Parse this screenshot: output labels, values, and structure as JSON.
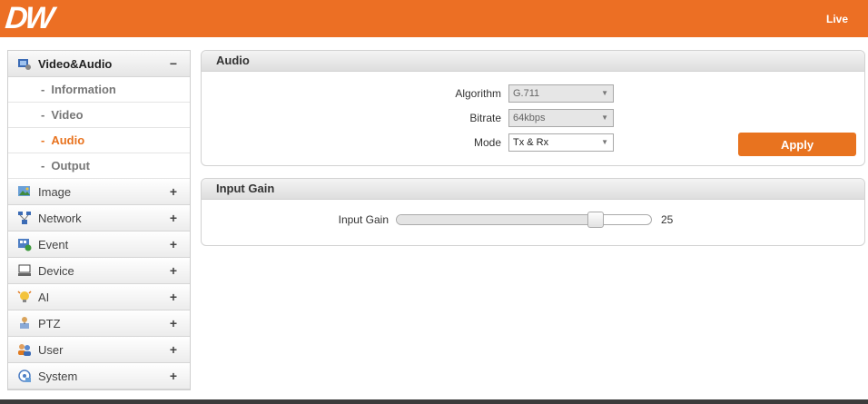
{
  "header": {
    "logo": "DW",
    "live_link": "Live"
  },
  "sidebar": {
    "groups": [
      {
        "label": "Video&Audio",
        "sign": "−",
        "icon": "video-audio-icon",
        "open": true
      },
      {
        "label": "Image",
        "sign": "+",
        "icon": "image-icon"
      },
      {
        "label": "Network",
        "sign": "+",
        "icon": "network-icon"
      },
      {
        "label": "Event",
        "sign": "+",
        "icon": "event-icon"
      },
      {
        "label": "Device",
        "sign": "+",
        "icon": "device-icon"
      },
      {
        "label": "AI",
        "sign": "+",
        "icon": "ai-icon"
      },
      {
        "label": "PTZ",
        "sign": "+",
        "icon": "ptz-icon"
      },
      {
        "label": "User",
        "sign": "+",
        "icon": "user-icon"
      },
      {
        "label": "System",
        "sign": "+",
        "icon": "system-icon"
      }
    ],
    "sub_items": [
      {
        "label": "Information"
      },
      {
        "label": "Video"
      },
      {
        "label": "Audio",
        "active": true
      },
      {
        "label": "Output"
      }
    ],
    "bullet": "-"
  },
  "audio": {
    "title": "Audio",
    "algorithm_label": "Algorithm",
    "algorithm_value": "G.711",
    "bitrate_label": "Bitrate",
    "bitrate_value": "64kbps",
    "mode_label": "Mode",
    "mode_value": "Tx & Rx",
    "apply_label": "Apply"
  },
  "input_gain": {
    "title": "Input Gain",
    "label": "Input Gain",
    "value": "25",
    "level_fraction": 0.78
  },
  "colors": {
    "accent": "#ec6f24",
    "footer": "#3c3c3c"
  }
}
